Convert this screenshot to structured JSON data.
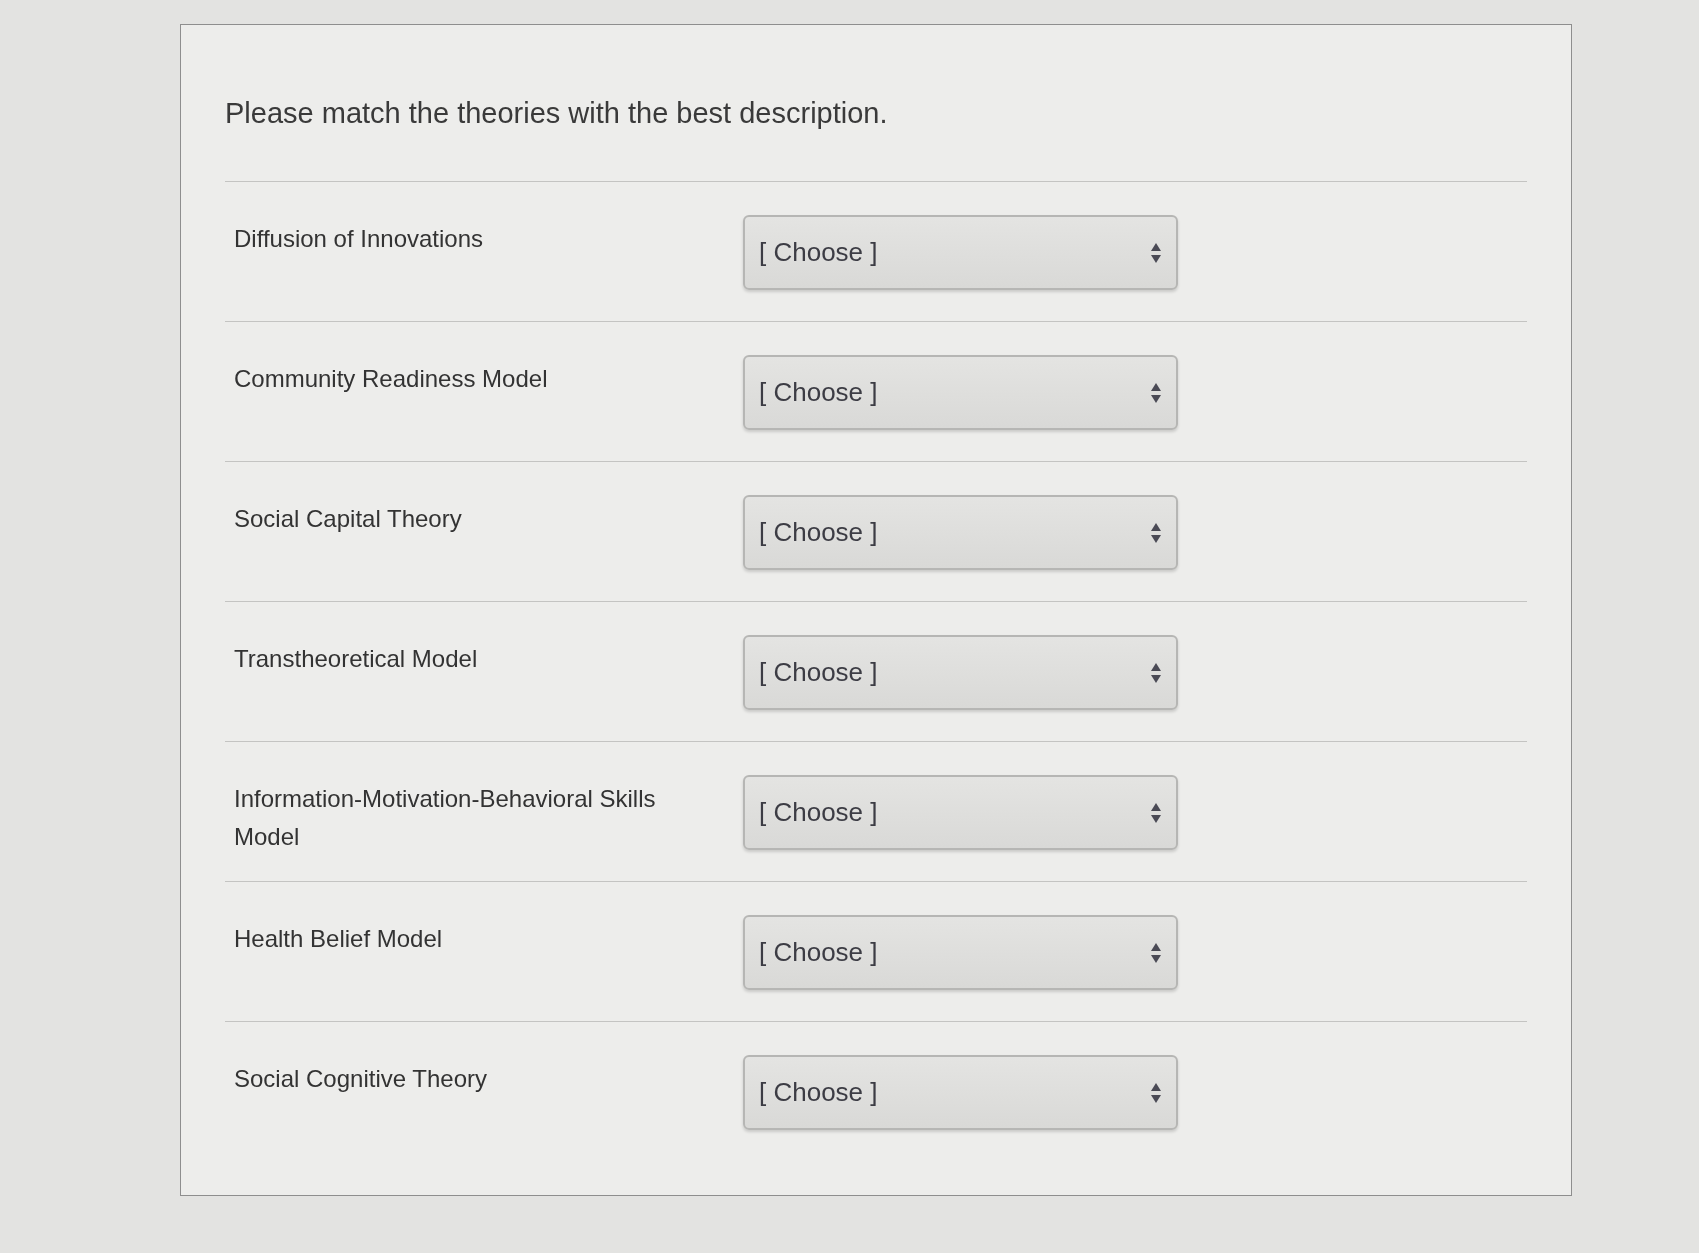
{
  "prompt": "Please match the theories with the best description.",
  "items": [
    {
      "term": "Diffusion of Innovations",
      "choice": "[ Choose ]"
    },
    {
      "term": "Community Readiness Model",
      "choice": "[ Choose ]"
    },
    {
      "term": "Social Capital Theory",
      "choice": "[ Choose ]"
    },
    {
      "term": "Transtheoretical Model",
      "choice": "[ Choose ]"
    },
    {
      "term": "Information-Motivation-Behavioral Skills Model",
      "choice": "[ Choose ]"
    },
    {
      "term": "Health Belief Model",
      "choice": "[ Choose ]"
    },
    {
      "term": "Social Cognitive Theory",
      "choice": "[ Choose ]"
    }
  ]
}
